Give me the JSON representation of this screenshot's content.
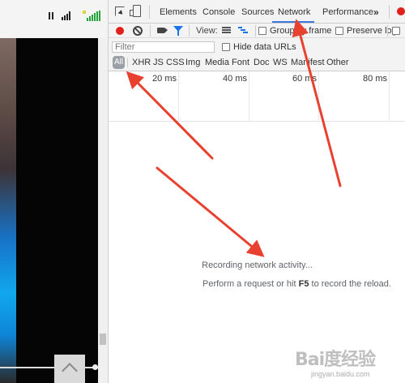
{
  "devtools": {
    "tabs": [
      {
        "label": "Elements"
      },
      {
        "label": "Console"
      },
      {
        "label": "Sources"
      },
      {
        "label": "Network",
        "active": true
      },
      {
        "label": "Performance"
      }
    ],
    "more_tabs_icon": "chevron-double-right-icon",
    "error_indicator_color": "#e0201b"
  },
  "toolbar": {
    "record_icon": "record-icon",
    "record_color": "#e0201b",
    "clear_icon": "clear-icon",
    "capture_screenshots_icon": "video-camera-icon",
    "filter_icon": "filter-icon",
    "view_label": "View:",
    "large_rows_icon": "large-rows-icon",
    "overview_icon": "waterfall-overview-icon",
    "group_by_frame_label": "Group by frame",
    "preserve_log_label": "Preserve log",
    "disable_cache_checked": false
  },
  "filter_bar": {
    "placeholder": "Filter",
    "hide_data_urls_label": "Hide data URLs",
    "resource_types": [
      "All",
      "XHR",
      "JS",
      "CSS",
      "Img",
      "Media",
      "Font",
      "Doc",
      "WS",
      "Manifest",
      "Other"
    ],
    "selected_type": "All"
  },
  "timeline": {
    "ticks": [
      "20 ms",
      "40 ms",
      "60 ms",
      "80 ms"
    ]
  },
  "empty_state": {
    "line1": "Recording network activity...",
    "line2_prefix": "Perform a request or hit ",
    "line2_key": "F5",
    "line2_suffix": " to record the reload."
  },
  "watermark": {
    "logo": "Bai度经验",
    "url": "jingyan.baidu.com"
  },
  "accent_color": "#3879d9",
  "annotation_color": "#e8412f"
}
